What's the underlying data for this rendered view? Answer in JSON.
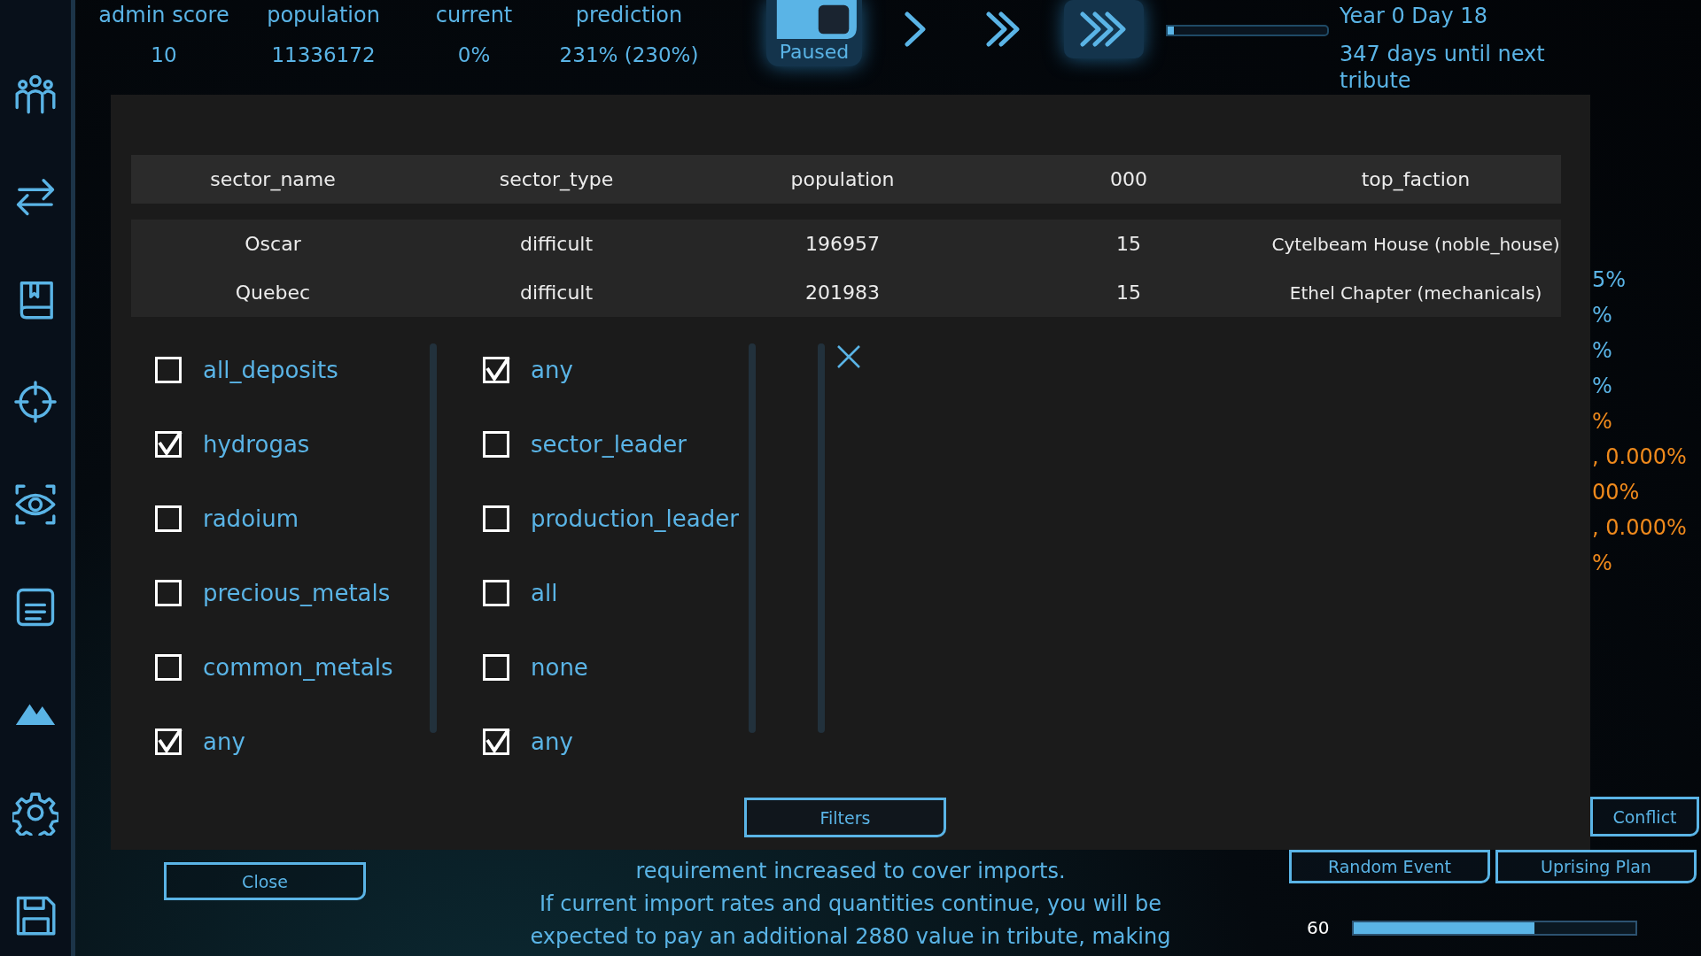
{
  "stats": [
    {
      "label": "admin score",
      "value": "10"
    },
    {
      "label": "population",
      "value": "11336172"
    },
    {
      "label": "current",
      "value": "0%"
    },
    {
      "label": "prediction",
      "value": "231% (230%)"
    }
  ],
  "speed_buttons": [
    {
      "kind": "pause",
      "label": "Paused",
      "selected": true
    },
    {
      "kind": "speed1",
      "selected": false
    },
    {
      "kind": "speed2",
      "selected": false
    },
    {
      "kind": "speed3",
      "selected": true
    }
  ],
  "tribute_progress": {
    "level": 0.04
  },
  "date": "Year 0 Day 18",
  "countdown": "347 days until next tribute",
  "sidebar": {
    "items": [
      {
        "kind": "people"
      },
      {
        "kind": "transfer"
      },
      {
        "kind": "book"
      },
      {
        "kind": "crosshair"
      },
      {
        "kind": "eye"
      },
      {
        "kind": "document"
      },
      {
        "kind": "mountains"
      },
      {
        "kind": "settings"
      },
      {
        "kind": "save"
      }
    ]
  },
  "table": {
    "columns": [
      "sector_name",
      "sector_type",
      "population",
      "000",
      "top_faction"
    ],
    "rows": [
      [
        "Oscar",
        "difficult",
        "196957",
        "15",
        "Cytelbeam House (noble_house)"
      ],
      [
        "Quebec",
        "difficult",
        "201983",
        "15",
        "Ethel Chapter (mechanicals)"
      ]
    ]
  },
  "filters": [
    [
      {
        "label": "all_deposits",
        "checked": false
      },
      {
        "label": "hydrogas",
        "checked": true
      },
      {
        "label": "radoium",
        "checked": false
      },
      {
        "label": "precious_metals",
        "checked": false
      },
      {
        "label": "common_metals",
        "checked": false
      },
      {
        "label": "any",
        "checked": true
      }
    ],
    [
      {
        "label": "any",
        "checked": true
      },
      {
        "label": "sector_leader",
        "checked": false
      },
      {
        "label": "production_leader",
        "checked": false
      },
      {
        "label": "all",
        "checked": false
      },
      {
        "label": "none",
        "checked": false
      },
      {
        "label": "any",
        "checked": true
      }
    ]
  ],
  "filters_button": "Filters",
  "close_button": "Close",
  "side_values": [
    {
      "text": "5%",
      "color": "#5ab4e6"
    },
    {
      "text": "%",
      "color": "#5ab4e6"
    },
    {
      "text": "%",
      "color": "#5ab4e6"
    },
    {
      "text": "%",
      "color": "#5ab4e6"
    },
    {
      "text": "%",
      "color": "#f08a1c"
    },
    {
      "text": ", 0.000%",
      "color": "#f08a1c"
    },
    {
      "text": "00%",
      "color": "#f08a1c"
    },
    {
      "text": ", 0.000%",
      "color": "#f08a1c"
    },
    {
      "text": "%",
      "color": "#f08a1c"
    }
  ],
  "message": [
    "requirement increased to cover imports.",
    "If current import rates and quantities continue, you will be",
    "expected to pay an additional 2880 value in tribute, making"
  ],
  "action_buttons": [
    "Conflict",
    "Random Event",
    "Uprising Plan"
  ],
  "slider": {
    "reading": "60",
    "level": 0.64
  }
}
